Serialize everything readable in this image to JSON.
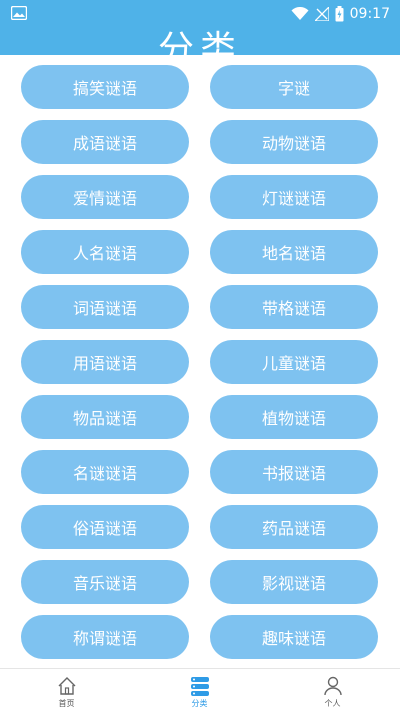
{
  "status_bar": {
    "time": "09:17",
    "icons": [
      "image-icon",
      "wifi-icon",
      "signal-icon",
      "battery-charging-icon"
    ]
  },
  "header": {
    "title": "分类"
  },
  "categories": [
    "搞笑谜语",
    "字谜",
    "成语谜语",
    "动物谜语",
    "爱情谜语",
    "灯谜谜语",
    "人名谜语",
    "地名谜语",
    "词语谜语",
    "带格谜语",
    "用语谜语",
    "儿童谜语",
    "物品谜语",
    "植物谜语",
    "名谜谜语",
    "书报谜语",
    "俗语谜语",
    "药品谜语",
    "音乐谜语",
    "影视谜语",
    "称谓谜语",
    "趣味谜语"
  ],
  "bottom_nav": {
    "items": [
      {
        "label": "首页",
        "icon": "home-icon"
      },
      {
        "label": "分类",
        "icon": "category-icon",
        "active": true
      },
      {
        "label": "个人",
        "icon": "user-icon"
      }
    ]
  },
  "colors": {
    "header_blue": "#4fb2e8",
    "button_blue": "#7ec2f0",
    "active_blue": "#2e9be6"
  }
}
